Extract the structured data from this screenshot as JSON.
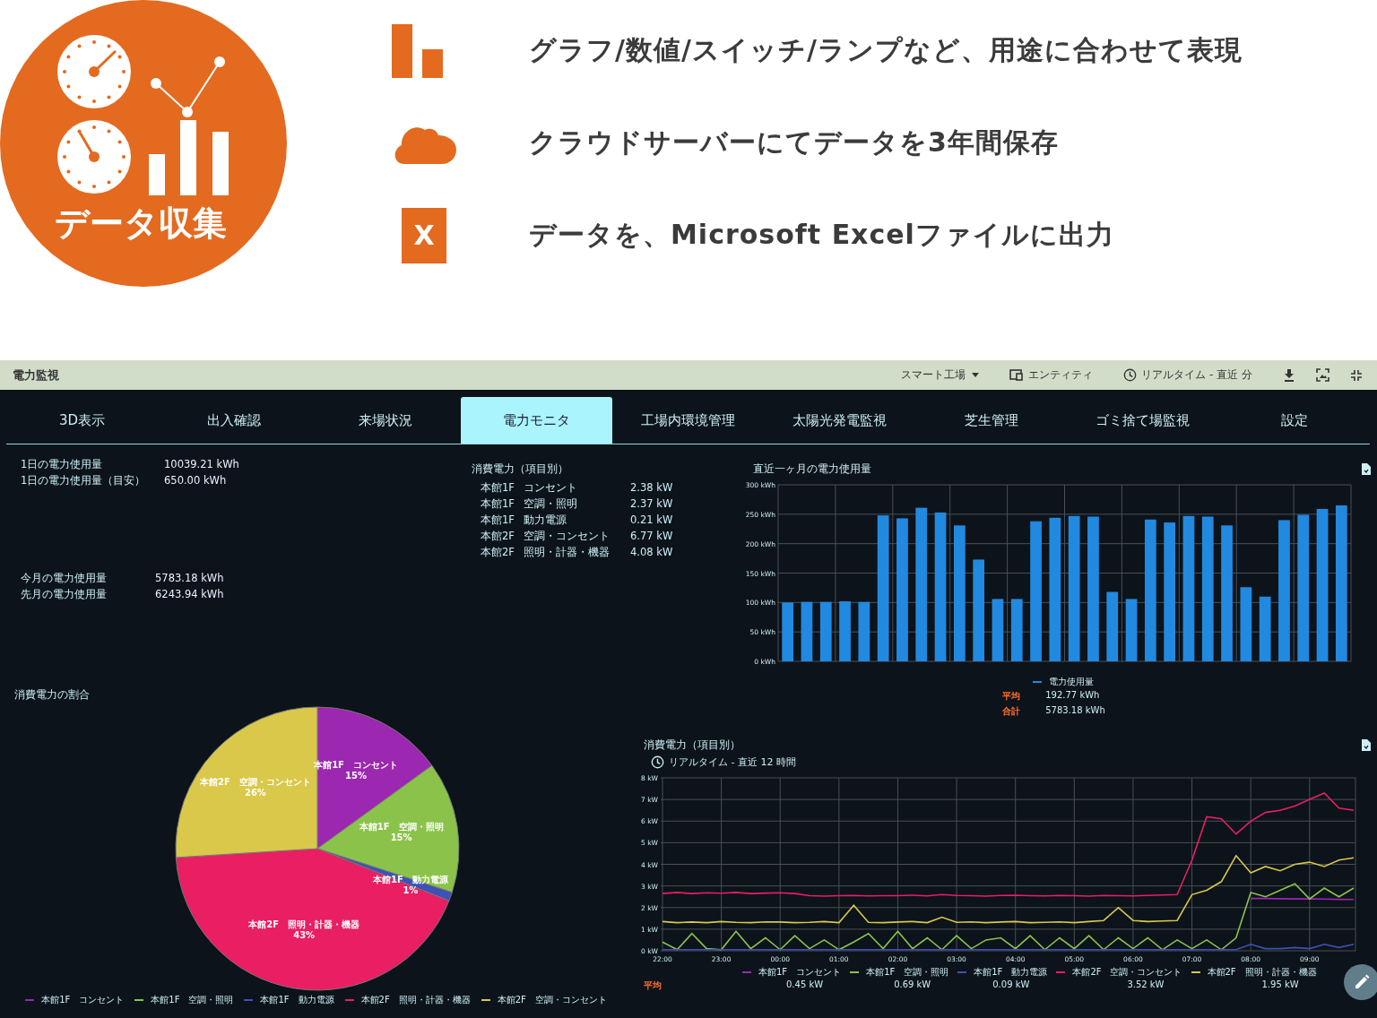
{
  "banner": {
    "title": "データ収集",
    "features": [
      {
        "kind": "chart",
        "text": "グラフ/数値/スイッチ/ランプなど、用途に合わせて表現"
      },
      {
        "kind": "cloud",
        "text": "クラウドサーバーにてデータを3年間保存"
      },
      {
        "kind": "excel",
        "icon_label": "X",
        "text": "データを、Microsoft Excelファイルに出力"
      }
    ]
  },
  "dashboard": {
    "title": "電力監視",
    "toolbar": {
      "site": "スマート工場",
      "entity": "エンティティ",
      "time_range": "リアルタイム - 直近 分"
    },
    "tabs": [
      {
        "label": "3D表示",
        "selected": false
      },
      {
        "label": "出入確認",
        "selected": false
      },
      {
        "label": "来場状況",
        "selected": false
      },
      {
        "label": "電力モニタ",
        "selected": true
      },
      {
        "label": "工場内環境管理",
        "selected": false
      },
      {
        "label": "太陽光発電監視",
        "selected": false
      },
      {
        "label": "芝生管理",
        "selected": false
      },
      {
        "label": "ゴミ捨て場監視",
        "selected": false
      },
      {
        "label": "設定",
        "selected": false
      }
    ],
    "daily_stats": [
      {
        "label": "1日の電力使用量",
        "value": "10039.21 kWh"
      },
      {
        "label": "1日の電力使用量（目安）",
        "value": "650.00 kWh"
      }
    ],
    "monthly_stats": [
      {
        "label": "今月の電力使用量",
        "value": "5783.18 kWh"
      },
      {
        "label": "先月の電力使用量",
        "value": "6243.94 kWh"
      }
    ],
    "breakdown": {
      "title": "消費電力（項目別）",
      "rows": [
        {
          "building": "本館1F",
          "item": "コンセント",
          "value": "2.38 kW"
        },
        {
          "building": "本館1F",
          "item": "空調・照明",
          "value": "2.37 kW"
        },
        {
          "building": "本館1F",
          "item": "動力電源",
          "value": "0.21 kW"
        },
        {
          "building": "本館2F",
          "item": "空調・コンセント",
          "value": "6.77 kW"
        },
        {
          "building": "本館2F",
          "item": "照明・計器・機器",
          "value": "4.08 kW"
        }
      ]
    },
    "monthly_chart": {
      "title": "直近一ヶ月の電力使用量",
      "chart_data": {
        "type": "bar",
        "grid": true,
        "ylim": [
          0,
          300
        ],
        "yticks": [
          {
            "value": 0,
            "label": "0 kWh"
          },
          {
            "value": 50,
            "label": "50 kWh"
          },
          {
            "value": 100,
            "label": "100 kWh"
          },
          {
            "value": 150,
            "label": "150 kWh"
          },
          {
            "value": 200,
            "label": "200 kWh"
          },
          {
            "value": 250,
            "label": "250 kWh"
          },
          {
            "value": 300,
            "label": "300 kWh"
          }
        ],
        "series": [
          {
            "name": "電力使用量",
            "color": "#2189e0",
            "values": [
              100,
              101,
              101,
              102,
              101,
              248,
              243,
              261,
              253,
              231,
              173,
              106,
              106,
              238,
              244,
              247,
              246,
              118,
              106,
              241,
              236,
              247,
              246,
              231,
              126,
              110,
              240,
              249,
              259,
              265
            ]
          }
        ]
      },
      "summary": [
        {
          "label": "平均",
          "value": "192.77 kWh"
        },
        {
          "label": "合計",
          "value": "5783.18 kWh"
        }
      ]
    },
    "share_chart": {
      "title": "消費電力の割合",
      "chart_data": {
        "type": "pie",
        "categories": [
          "本館1F　コンセント",
          "本館1F　空調・照明",
          "本館1F　動力電源",
          "本館2F　照明・計器・機器",
          "本館2F　空調・コンセント"
        ],
        "values": [
          15,
          15,
          1,
          43,
          26
        ],
        "value_labels": [
          "15%",
          "15%",
          "1%",
          "43%",
          "26%"
        ]
      },
      "slice_colors": [
        {
          "color": "#9c27b0"
        },
        {
          "color": "#8bc34a"
        },
        {
          "color": "#3f51b5"
        },
        {
          "color": "#e91e63"
        },
        {
          "color": "#d9c84a"
        }
      ]
    },
    "realtime_chart": {
      "title": "消費電力（項目別）",
      "range": "リアルタイム - 直近 12 時間",
      "chart_data": {
        "type": "line",
        "grid": true,
        "ylim": [
          0,
          8
        ],
        "categories": [
          "22:00",
          null,
          null,
          null,
          "23:00",
          null,
          null,
          null,
          "00:00",
          null,
          null,
          null,
          "01:00",
          null,
          null,
          null,
          "02:00",
          null,
          null,
          null,
          "03:00",
          null,
          null,
          null,
          "04:00",
          null,
          null,
          null,
          "05:00",
          null,
          null,
          null,
          "06:00",
          null,
          null,
          null,
          "07:00",
          null,
          null,
          null,
          "08:00",
          null,
          null,
          null,
          "09:00",
          null,
          null,
          null
        ],
        "yticks": [
          {
            "value": 0,
            "label": "0 kW"
          },
          {
            "value": 1,
            "label": "1 kW"
          },
          {
            "value": 2,
            "label": "2 kW"
          },
          {
            "value": 3,
            "label": "3 kW"
          },
          {
            "value": 4,
            "label": "4 kW"
          },
          {
            "value": 5,
            "label": "5 kW"
          },
          {
            "value": 6,
            "label": "6 kW"
          },
          {
            "value": 7,
            "label": "7 kW"
          },
          {
            "value": 8,
            "label": "8 kW"
          }
        ],
        "series": [
          {
            "name": "本館1F　コンセント",
            "color": "#9c27b0",
            "values": [
              null,
              null,
              null,
              null,
              null,
              null,
              null,
              null,
              null,
              null,
              null,
              null,
              null,
              null,
              null,
              null,
              null,
              null,
              null,
              null,
              null,
              null,
              null,
              null,
              null,
              null,
              null,
              null,
              null,
              null,
              null,
              null,
              null,
              null,
              null,
              null,
              null,
              null,
              null,
              null,
              2.42,
              2.42,
              2.41,
              2.4,
              2.4,
              2.39,
              2.38,
              2.37
            ]
          },
          {
            "name": "本館1F　空調・照明",
            "color": "#8bc34a",
            "values": [
              0.4,
              0.05,
              0.8,
              0.1,
              0.05,
              0.9,
              0.1,
              0.6,
              0.05,
              0.7,
              0.1,
              0.5,
              0.05,
              0.4,
              0.8,
              0.1,
              0.9,
              0.1,
              0.6,
              0.05,
              0.7,
              0.1,
              0.5,
              0.6,
              0.1,
              0.7,
              0.05,
              0.6,
              0.1,
              0.7,
              0.05,
              0.6,
              0.1,
              0.6,
              0.05,
              0.5,
              0.1,
              0.5,
              0.05,
              0.6,
              2.7,
              2.5,
              2.8,
              3.1,
              2.4,
              2.9,
              2.5,
              2.9
            ]
          },
          {
            "name": "本館1F　動力電源",
            "color": "#3f51b5",
            "values": [
              0.05,
              0.05,
              0.05,
              0.05,
              0.05,
              0.05,
              0.05,
              0.05,
              0.05,
              0.05,
              0.05,
              0.05,
              0.05,
              0.05,
              0.05,
              0.05,
              0.05,
              0.05,
              0.05,
              0.05,
              0.05,
              0.05,
              0.05,
              0.05,
              0.05,
              0.05,
              0.05,
              0.05,
              0.05,
              0.05,
              0.05,
              0.05,
              0.05,
              0.05,
              0.05,
              0.05,
              0.05,
              0.05,
              0.05,
              0.05,
              0.3,
              0.1,
              0.1,
              0.15,
              0.1,
              0.3,
              0.15,
              0.3
            ]
          },
          {
            "name": "本館2F　空調・コンセント",
            "color": "#e91e63",
            "values": [
              2.65,
              2.7,
              2.65,
              2.68,
              2.66,
              2.7,
              2.65,
              2.67,
              2.68,
              2.65,
              2.55,
              2.53,
              2.55,
              2.56,
              2.54,
              2.55,
              2.55,
              2.57,
              2.54,
              2.6,
              2.56,
              2.55,
              2.53,
              2.56,
              2.57,
              2.55,
              2.54,
              2.56,
              2.55,
              2.53,
              2.56,
              2.55,
              2.54,
              2.56,
              2.58,
              2.6,
              4.2,
              6.2,
              6.1,
              5.4,
              6.0,
              6.4,
              6.5,
              6.7,
              7.0,
              7.3,
              6.6,
              6.5
            ]
          },
          {
            "name": "本館2F　照明・計器・機器",
            "color": "#d9c84a",
            "values": [
              1.35,
              1.3,
              1.33,
              1.3,
              1.35,
              1.32,
              1.3,
              1.34,
              1.33,
              1.3,
              1.32,
              1.35,
              1.3,
              2.1,
              1.32,
              1.3,
              1.33,
              1.35,
              1.3,
              1.55,
              1.32,
              1.34,
              1.3,
              1.33,
              1.35,
              1.3,
              1.32,
              1.34,
              1.3,
              1.35,
              1.4,
              2.0,
              1.4,
              1.35,
              1.38,
              1.4,
              2.6,
              2.8,
              3.2,
              4.4,
              3.6,
              3.9,
              3.7,
              4.0,
              4.1,
              3.9,
              4.2,
              4.3
            ]
          }
        ]
      },
      "average_label": "平均",
      "averages": [
        "0.45 kW",
        "0.69 kW",
        "0.09 kW",
        "3.52 kW",
        "1.95 kW"
      ]
    }
  }
}
